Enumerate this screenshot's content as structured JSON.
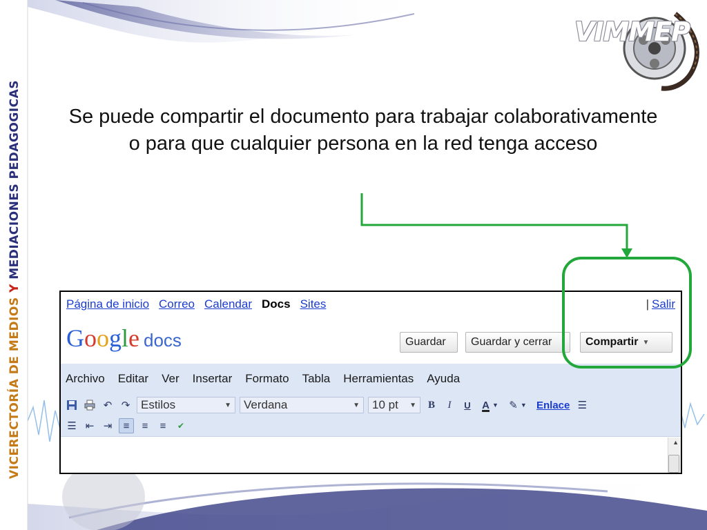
{
  "slide": {
    "caption": "Se puede compartir el documento para trabajar colaborativamente o para que cualquier persona en la red tenga acceso",
    "banner": {
      "part1": "VICERECTORÍA DE MEDIOS ",
      "part2": "Y ",
      "part3": "MEDIACIONES PEDAGOGICAS"
    },
    "logo_text": "VIMMEP",
    "highlight_color": "#22a83a",
    "accent_colors": {
      "banner_orange": "#c47a16",
      "banner_navy": "#2a2f7a",
      "banner_red": "#c8231a"
    }
  },
  "app": {
    "topnav": {
      "links": [
        "Página de inicio",
        "Correo",
        "Calendar"
      ],
      "current": "Docs",
      "sites": "Sites",
      "separator": "|",
      "signout": "Salir"
    },
    "logo": {
      "g1": "G",
      "g2": "o",
      "g3": "o",
      "g4": "g",
      "g5": "l",
      "g6": "e",
      "product": "docs"
    },
    "buttons": {
      "save": "Guardar",
      "save_close": "Guardar y cerrar",
      "share": "Compartir"
    },
    "menu": [
      "Archivo",
      "Editar",
      "Ver",
      "Insertar",
      "Formato",
      "Tabla",
      "Herramientas",
      "Ayuda"
    ],
    "toolbar": {
      "styles": "Estilos",
      "font": "Verdana",
      "size": "10 pt",
      "bold": "B",
      "italic": "I",
      "underline": "U",
      "text_color": "A",
      "link": "Enlace",
      "icons_row1": [
        "save-icon",
        "print-icon",
        "undo-icon",
        "redo-icon",
        "text-color-icon",
        "highlight-icon",
        "numbered-list-icon"
      ],
      "icons_row2": [
        "bulleted-list-icon",
        "outdent-icon",
        "indent-icon",
        "align-left-icon",
        "align-center-icon",
        "align-right-icon",
        "spellcheck-icon"
      ]
    }
  }
}
